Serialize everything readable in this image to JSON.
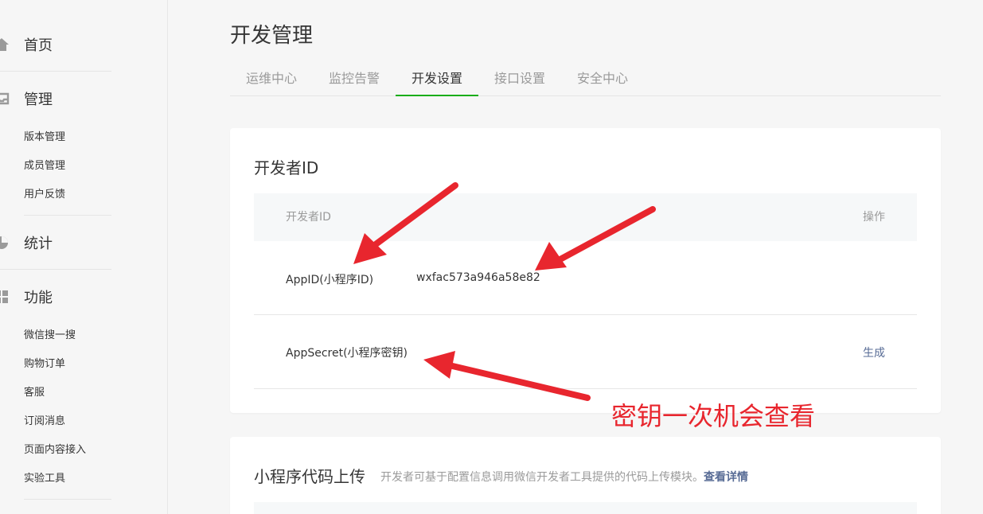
{
  "sidebar": {
    "home": {
      "label": "首页",
      "icon": "home-icon"
    },
    "manage": {
      "label": "管理",
      "icon": "inbox-icon",
      "items": [
        "版本管理",
        "成员管理",
        "用户反馈"
      ]
    },
    "stats": {
      "label": "统计",
      "icon": "pie-chart-icon"
    },
    "features": {
      "label": "功能",
      "icon": "grid-icon",
      "items": [
        "微信搜一搜",
        "购物订单",
        "客服",
        "订阅消息",
        "页面内容接入",
        "实验工具"
      ]
    }
  },
  "page": {
    "title": "开发管理"
  },
  "tabs": [
    {
      "label": "运维中心",
      "active": false
    },
    {
      "label": "监控告警",
      "active": false
    },
    {
      "label": "开发设置",
      "active": true
    },
    {
      "label": "接口设置",
      "active": false
    },
    {
      "label": "安全中心",
      "active": false
    }
  ],
  "dev_id_card": {
    "title": "开发者ID",
    "headers": {
      "col1": "开发者ID",
      "col2": "操作"
    },
    "rows": [
      {
        "label": "AppID(小程序ID)",
        "value": "wxfac573a946a58e82",
        "action": ""
      },
      {
        "label": "AppSecret(小程序密钥)",
        "value": "",
        "action": "生成"
      }
    ]
  },
  "upload_card": {
    "title": "小程序代码上传",
    "description": "开发者可基于配置信息调用微信开发者工具提供的代码上传模块。",
    "link": "查看详情"
  },
  "annotation": {
    "text": "密钥一次机会查看",
    "color": "#e8262e"
  },
  "colors": {
    "accent": "#1aad19",
    "link": "#576b95",
    "annotation": "#e8262e"
  }
}
